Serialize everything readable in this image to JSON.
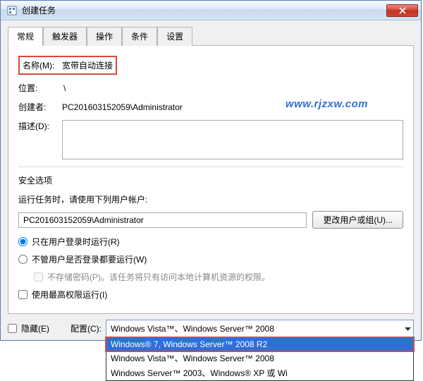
{
  "window": {
    "title": "创建任务"
  },
  "tabs": {
    "items": [
      {
        "label": "常规",
        "active": true
      },
      {
        "label": "触发器",
        "active": false
      },
      {
        "label": "操作",
        "active": false
      },
      {
        "label": "条件",
        "active": false
      },
      {
        "label": "设置",
        "active": false
      }
    ]
  },
  "form": {
    "name_label": "名称(M):",
    "name_value": "宽带自动连接",
    "location_label": "位置:",
    "location_value": "\\",
    "creator_label": "创建者:",
    "creator_value": "PC201603152059\\Administrator",
    "description_label": "描述(D):",
    "description_value": ""
  },
  "security": {
    "title": "安全选项",
    "run_as_label": "运行任务时，请使用下列用户帐户:",
    "account_value": "PC201603152059\\Administrator",
    "change_user_button": "更改用户或组(U)...",
    "radio_logged_on": "只在用户登录时运行(R)",
    "radio_logged_off": "不管用户是否登录都要运行(W)",
    "store_password_label": "不存储密码(P)。该任务将只有访问本地计算机资源的权限。",
    "highest_priv_label": "使用最高权限运行(I)"
  },
  "bottom": {
    "hidden_label": "隐藏(E)",
    "config_label": "配置(C):",
    "config_selected": "Windows Vista™、Windows Server™ 2008",
    "config_options": [
      "Windows® 7, Windows Server™ 2008 R2",
      "Windows Vista™、Windows Server™ 2008",
      "Windows Server™ 2003、Windows® XP 或 Wi"
    ]
  },
  "watermark": "www.rjzxw.com"
}
